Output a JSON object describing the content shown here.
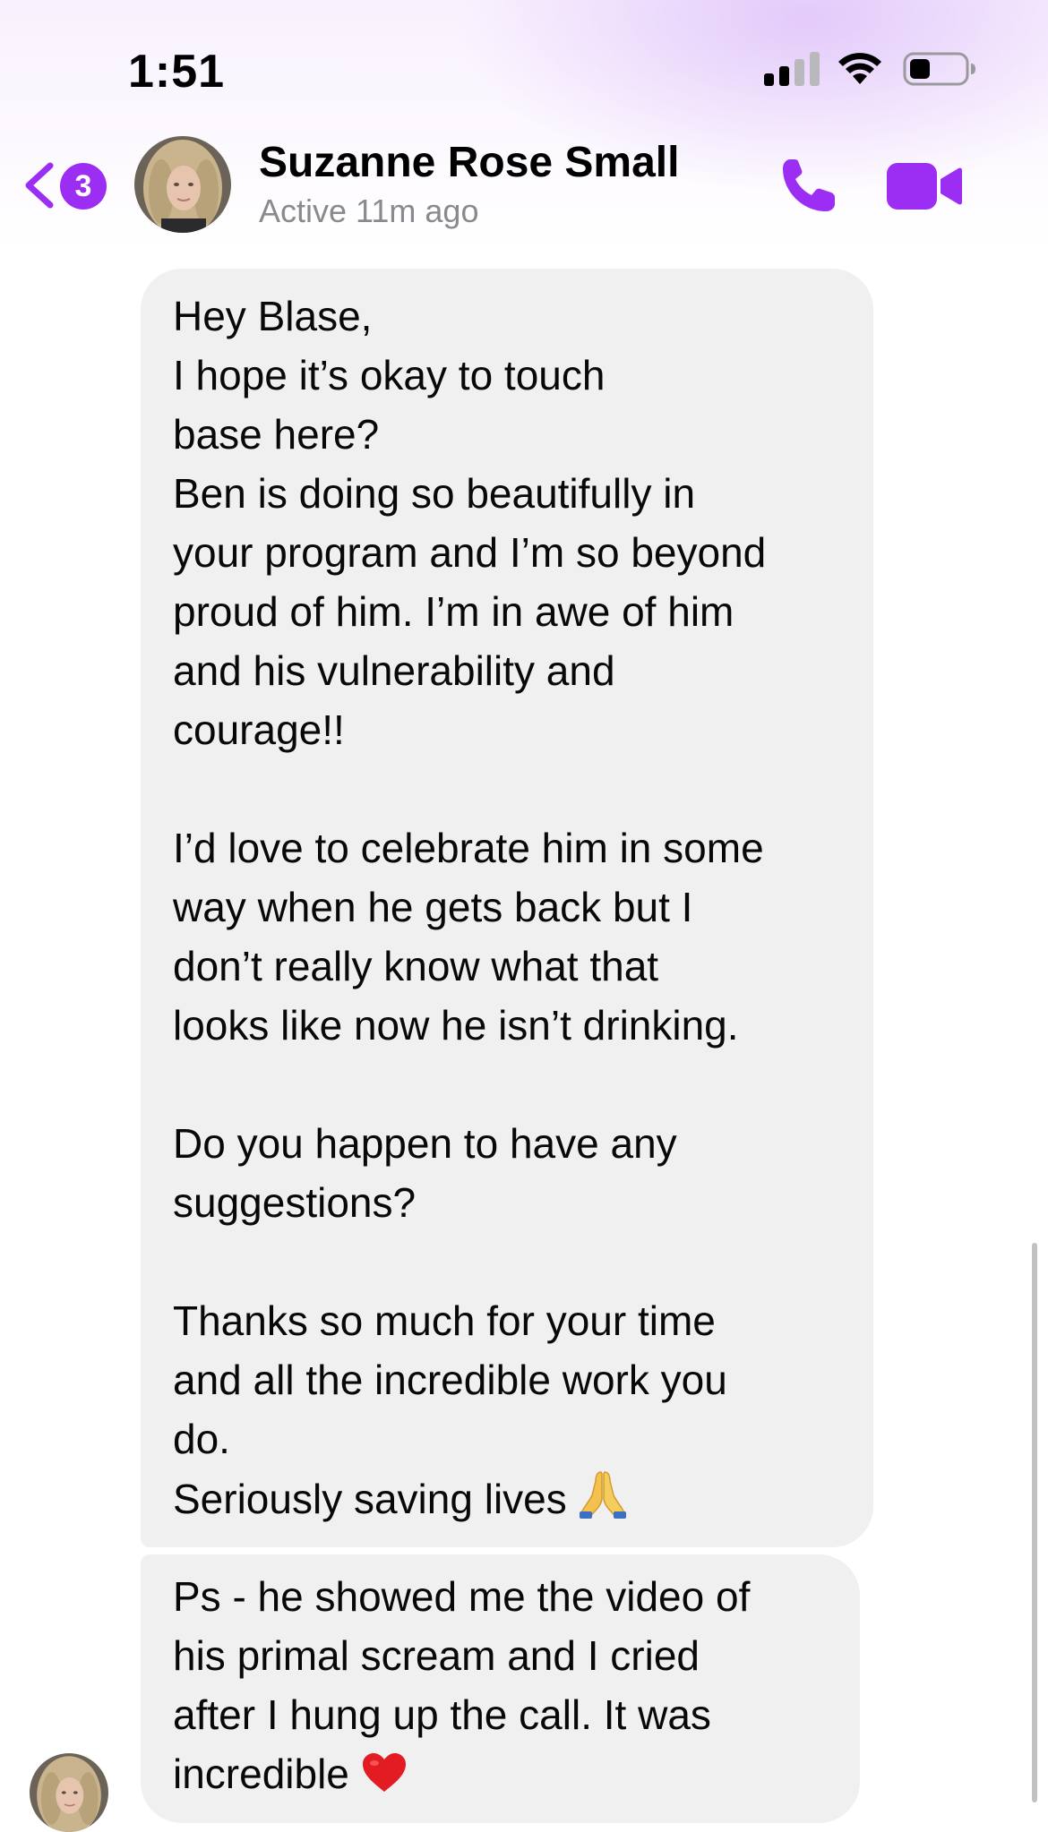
{
  "status_bar": {
    "time": "1:51"
  },
  "header": {
    "back_badge_count": "3",
    "contact_name": "Suzanne Rose Small",
    "contact_status": "Active 11m ago",
    "icons": {
      "back": "chevron-left-icon",
      "call": "phone-icon",
      "video": "video-camera-icon"
    },
    "accent_color": "#9b2ef2"
  },
  "messages": [
    {
      "sender": "Suzanne Rose Small",
      "text": "Hey Blase,\nI hope it’s okay to touch\nbase here?\nBen is doing so beautifully in\nyour program and I’m so beyond\nproud of him. I’m in awe of him\nand his vulnerability and\ncourage!!\n\nI’d love to celebrate him in some\nway when he gets back but I\ndon’t really know what that\nlooks like now he isn’t drinking.\n\nDo you happen to have any\nsuggestions?\n\nThanks so much for your time\nand all the incredible work you\ndo.\nSeriously saving lives",
      "emoji": "praying-hands-icon"
    },
    {
      "sender": "Suzanne Rose Small",
      "text": "Ps - he showed me the video of\nhis primal scream and I cried\nafter I hung up the call. It was\nincredible",
      "emoji": "red-heart-icon"
    }
  ],
  "colors": {
    "bubble_incoming": "#f0f0f0",
    "secondary_text": "#8a8a8e"
  }
}
